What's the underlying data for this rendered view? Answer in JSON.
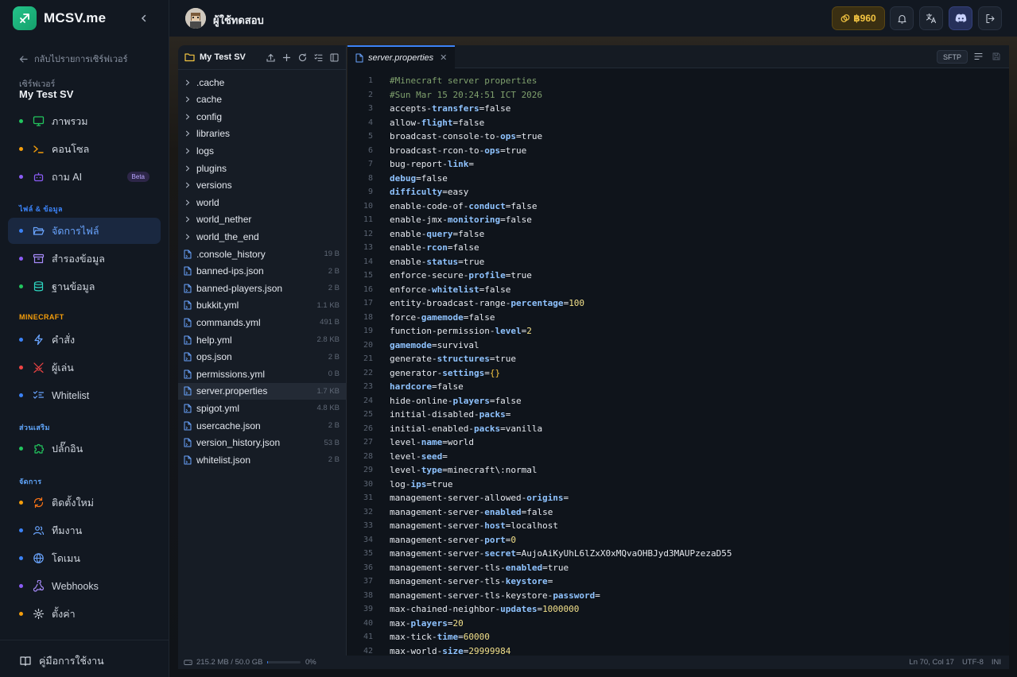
{
  "brand": {
    "name": "MCSV.me"
  },
  "sidebar": {
    "back_label": "กลับไปรายการเซิร์ฟเวอร์",
    "server_caption": "เซิร์ฟเวอร์",
    "server_name": "My Test SV",
    "overview": "ภาพรวม",
    "console": "คอนโซล",
    "ask_ai": "ถาม AI",
    "beta": "Beta",
    "section_files": "ไฟล์ & ข้อมูล",
    "file_manager": "จัดการไฟล์",
    "backup": "สำรองข้อมูล",
    "database": "ฐานข้อมูล",
    "section_minecraft": "MINECRAFT",
    "commands": "คำสั่ง",
    "players": "ผู้เล่น",
    "whitelist": "Whitelist",
    "section_addons": "ส่วนเสริม",
    "plugins": "ปลั๊กอิน",
    "section_manage": "จัดการ",
    "reinstall": "ติดตั้งใหม่",
    "team": "ทีมงาน",
    "domain": "โดเมน",
    "webhooks": "Webhooks",
    "settings": "ตั้งค่า",
    "manual": "คู่มือการใช้งาน",
    "colors": {
      "active_bg": "#1a2840",
      "active_text": "#6aa5ff",
      "dot_green": "#22c55e",
      "dot_amber": "#f59e0b",
      "dot_blue": "#3b82f6",
      "dot_purple": "#8b5cf6"
    }
  },
  "topbar": {
    "username": "ผู้ใช้ทดสอบ",
    "coins": "฿960"
  },
  "file_panel": {
    "title": "My Test SV",
    "folders": [
      ".cache",
      "cache",
      "config",
      "libraries",
      "logs",
      "plugins",
      "versions",
      "world",
      "world_nether",
      "world_the_end"
    ],
    "files": [
      {
        "name": ".console_history",
        "size": "19 B"
      },
      {
        "name": "banned-ips.json",
        "size": "2 B"
      },
      {
        "name": "banned-players.json",
        "size": "2 B"
      },
      {
        "name": "bukkit.yml",
        "size": "1.1 KB"
      },
      {
        "name": "commands.yml",
        "size": "491 B"
      },
      {
        "name": "help.yml",
        "size": "2.8 KB"
      },
      {
        "name": "ops.json",
        "size": "2 B"
      },
      {
        "name": "permissions.yml",
        "size": "0 B"
      },
      {
        "name": "server.properties",
        "size": "1.7 KB"
      },
      {
        "name": "spigot.yml",
        "size": "4.8 KB"
      },
      {
        "name": "usercache.json",
        "size": "2 B"
      },
      {
        "name": "version_history.json",
        "size": "53 B"
      },
      {
        "name": "whitelist.json",
        "size": "2 B"
      }
    ]
  },
  "editor": {
    "tab_name": "server.properties",
    "sftp": "SFTP",
    "lines": [
      "#Minecraft server properties",
      "#Sun Mar 15 20:24:51 ICT 2026",
      "accepts-transfers=false",
      "allow-flight=false",
      "broadcast-console-to-ops=true",
      "broadcast-rcon-to-ops=true",
      "bug-report-link=",
      "debug=false",
      "difficulty=easy",
      "enable-code-of-conduct=false",
      "enable-jmx-monitoring=false",
      "enable-query=false",
      "enable-rcon=false",
      "enable-status=true",
      "enforce-secure-profile=true",
      "enforce-whitelist=false",
      "entity-broadcast-range-percentage=100",
      "force-gamemode=false",
      "function-permission-level=2",
      "gamemode=survival",
      "generate-structures=true",
      "generator-settings={}",
      "hardcore=false",
      "hide-online-players=false",
      "initial-disabled-packs=",
      "initial-enabled-packs=vanilla",
      "level-name=world",
      "level-seed=",
      "level-type=minecraft\\:normal",
      "log-ips=true",
      "management-server-allowed-origins=",
      "management-server-enabled=false",
      "management-server-host=localhost",
      "management-server-port=0",
      "management-server-secret=AujoAiKyUhL6lZxX0xMQvaOHBJyd3MAUPzezaD55",
      "management-server-tls-enabled=true",
      "management-server-tls-keystore=",
      "management-server-tls-keystore-password=",
      "max-chained-neighbor-updates=1000000",
      "max-players=20",
      "max-tick-time=60000",
      "max-world-size=29999984"
    ]
  },
  "statusbar": {
    "storage": "215.2 MB / 50.0 GB",
    "percent": "0%",
    "storage_fraction": 0.004,
    "cursor": "Ln 70, Col 17",
    "encoding": "UTF-8",
    "language": "INI"
  }
}
